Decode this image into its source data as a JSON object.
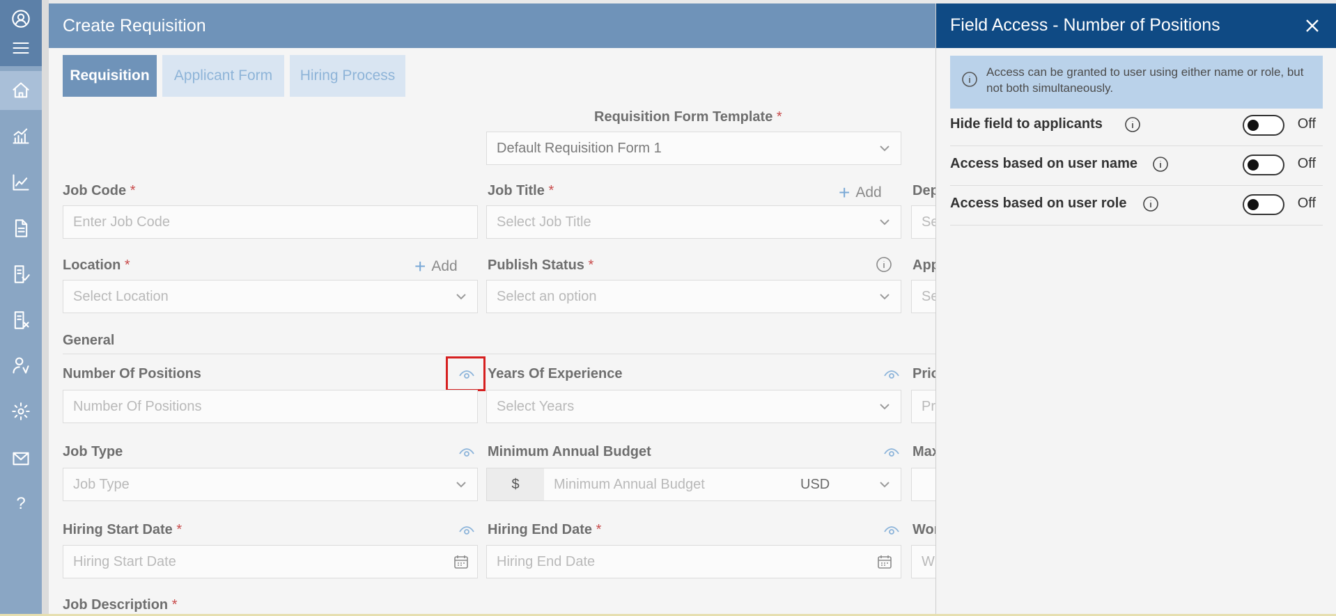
{
  "main": {
    "title": "Create Requisition",
    "tabs": [
      {
        "label": "Requisition",
        "active": true
      },
      {
        "label": "Applicant Form",
        "active": false
      },
      {
        "label": "Hiring Process",
        "active": false
      }
    ],
    "template_label": "Requisition Form Template",
    "template_value": "Default Requisition Form 1",
    "add_label": "Add",
    "required_mark": "*",
    "fields": {
      "job_code": {
        "label": "Job Code",
        "placeholder": "Enter Job Code"
      },
      "job_title": {
        "label": "Job Title",
        "placeholder": "Select Job Title"
      },
      "department": {
        "label": "Dep",
        "placeholder": "Se"
      },
      "location": {
        "label": "Location",
        "placeholder": "Select Location"
      },
      "publish_status": {
        "label": "Publish Status",
        "placeholder": "Select an option"
      },
      "approver": {
        "label": "App",
        "placeholder": "Se"
      },
      "number_of_positions": {
        "label": "Number Of Positions",
        "placeholder": "Number Of Positions"
      },
      "years_of_experience": {
        "label": "Years Of Experience",
        "placeholder": "Select Years"
      },
      "priority": {
        "label": "Prio",
        "placeholder": "Pr"
      },
      "job_type": {
        "label": "Job Type",
        "placeholder": "Job Type"
      },
      "min_budget": {
        "label": "Minimum Annual Budget",
        "placeholder": "Minimum Annual Budget",
        "currency_symbol": "$",
        "currency": "USD"
      },
      "max_budget": {
        "label": "Max"
      },
      "hiring_start": {
        "label": "Hiring Start Date",
        "placeholder": "Hiring Start Date"
      },
      "hiring_end": {
        "label": "Hiring End Date",
        "placeholder": "Hiring End Date"
      },
      "work": {
        "label": "Wor",
        "placeholder": "W"
      },
      "job_description": {
        "label": "Job Description"
      }
    },
    "section_general": "General"
  },
  "panel": {
    "title": "Field Access - Number of Positions",
    "note": "Access can be granted to user using either name or role, but not both simultaneously.",
    "rows": [
      {
        "label": "Hide field to applicants",
        "state": "Off",
        "on": false
      },
      {
        "label": "Access based on user name",
        "state": "Off",
        "on": false
      },
      {
        "label": "Access based on user role",
        "state": "Off",
        "on": false
      }
    ]
  },
  "colors": {
    "panel_header": "#0f4a84",
    "main_header": "#6f93b9",
    "required": "#c84a4a",
    "highlight": "#d62020"
  },
  "sidebar": {
    "icons": [
      "user-icon",
      "menu-icon",
      "home-icon",
      "bar-chart-icon",
      "line-chart-icon",
      "document-icon",
      "document-check-icon",
      "document-x-icon",
      "user-settings-icon",
      "gear-icon",
      "mail-icon",
      "help-icon"
    ]
  }
}
